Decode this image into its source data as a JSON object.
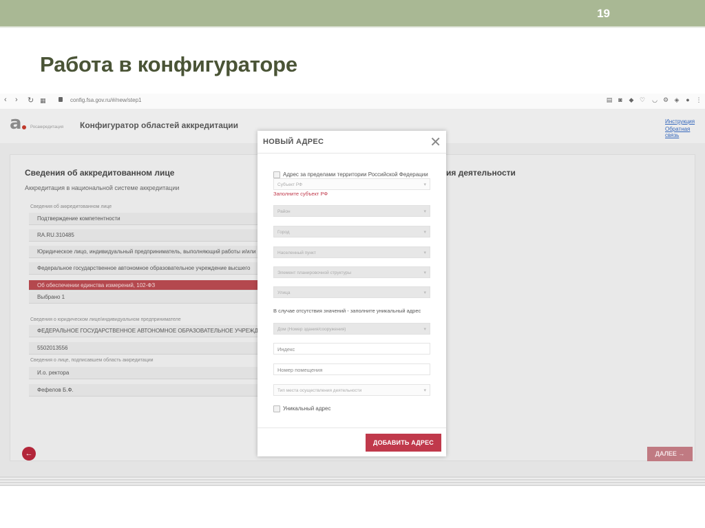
{
  "slide": {
    "number": "19",
    "title": "Работа в конфигураторе"
  },
  "browser": {
    "url": "config.fsa.gov.ru/#/new/step1"
  },
  "app": {
    "logo_text": "Росаккредитация",
    "title": "Конфигуратор областей аккредитации",
    "links": [
      "Инструкция",
      "Обратная связь"
    ]
  },
  "main": {
    "section_title": "Сведения об аккредитованном лице",
    "section_subtitle": "Аккредитация в национальной системе аккредитации",
    "right_section_title": "ия деятельности",
    "group1_label": "Сведения об аккредитованном лице",
    "fields1": [
      "Подтверждение компетентности",
      "RA.RU.310485",
      "Юридическое лицо, индивидуальный предприниматель, выполняющий работы и/или",
      "Федеральное государственное автономное образовательное учреждение высшего",
      "Об обеспечении единства измерений, 102-ФЗ",
      "Выбрано 1"
    ],
    "group2_label": "Сведения о юридическом лице/индивидуальном предпринимателе",
    "fields2": [
      "ФЕДЕРАЛЬНОЕ ГОСУДАРСТВЕННОЕ АВТОНОМНОЕ ОБРАЗОВАТЕЛЬНОЕ УЧРЕЖДЕНИЕ",
      "5502013556"
    ],
    "group3_label": "Сведения о лице, подписавшем область аккредитации",
    "fields3": [
      "И.о. ректора",
      "Фефелов Б.Ф."
    ],
    "next_label": "ДАЛЕЕ →"
  },
  "modal": {
    "title": "НОВЫЙ АДРЕС",
    "checkbox_outside_rf": "Адрес за пределами территории Российской Федерации",
    "subject_placeholder": "Субъект РФ",
    "subject_error": "Заполните субъект РФ",
    "district": "Район",
    "city": "Город",
    "locality": "Населенный пункт",
    "planning_element": "Элемент планировочной структуры",
    "street": "Улица",
    "note": "В случае отсутствия значений - заполните уникальный адрес",
    "house": "Дом (Номер здания/сооружения)",
    "index": "Индекс",
    "room": "Номер помещения",
    "activity_place_type": "Тип места осуществления деятельности",
    "unique_address": "Уникальный адрес",
    "add_button": "ДОБАВИТЬ АДРЕС"
  }
}
